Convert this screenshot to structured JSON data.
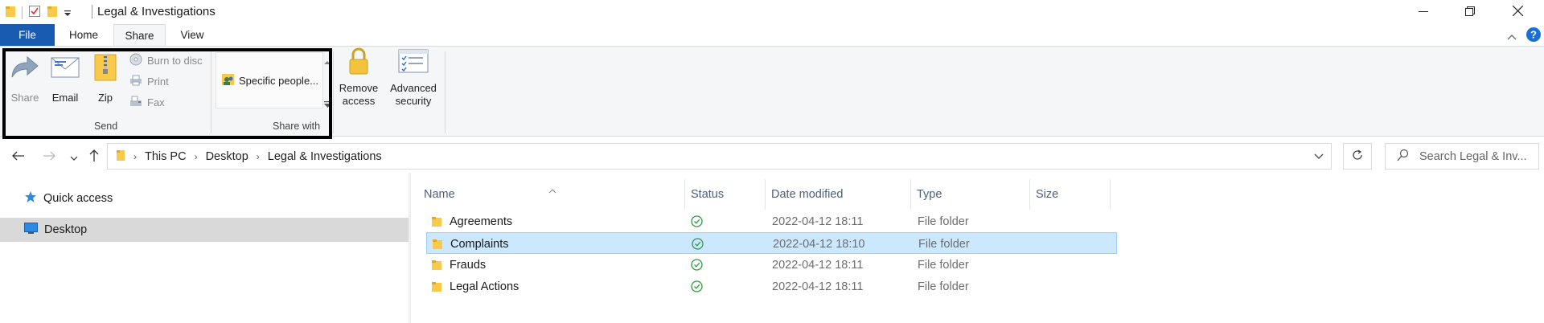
{
  "window": {
    "title": "Legal & Investigations",
    "controls": {
      "minimize_icon": "minimize-icon",
      "maximize_icon": "restore-icon",
      "close_icon": "close-icon"
    }
  },
  "ribbon_tabs": [
    {
      "label": "File"
    },
    {
      "label": "Home"
    },
    {
      "label": "Share"
    },
    {
      "label": "View"
    }
  ],
  "ribbon": {
    "send_group": {
      "label": "Send",
      "share": "Share",
      "email": "Email",
      "zip": "Zip",
      "burn_to_disc": "Burn to disc",
      "print": "Print",
      "fax": "Fax"
    },
    "share_with_group": {
      "label": "Share with",
      "specific_people": "Specific people..."
    },
    "remove_access": {
      "line1": "Remove",
      "line2": "access"
    },
    "advanced_security": {
      "line1": "Advanced",
      "line2": "security"
    }
  },
  "address_bar": {
    "crumbs": [
      "This PC",
      "Desktop",
      "Legal & Investigations"
    ]
  },
  "search": {
    "placeholder": "Search Legal & Inv..."
  },
  "nav_pane": {
    "items": [
      {
        "label": "Quick access",
        "icon": "star-icon"
      },
      {
        "label": "Desktop",
        "icon": "desktop-icon",
        "selected": true
      }
    ]
  },
  "file_list": {
    "columns": [
      "Name",
      "Status",
      "Date modified",
      "Type",
      "Size"
    ],
    "rows": [
      {
        "name": "Agreements",
        "date": "2022-04-12 18:11",
        "type": "File folder",
        "size": ""
      },
      {
        "name": "Complaints",
        "date": "2022-04-12 18:10",
        "type": "File folder",
        "size": "",
        "selected": true
      },
      {
        "name": "Frauds",
        "date": "2022-04-12 18:11",
        "type": "File folder",
        "size": ""
      },
      {
        "name": "Legal Actions",
        "date": "2022-04-12 18:11",
        "type": "File folder",
        "size": ""
      }
    ]
  },
  "colors": {
    "file_tab": "#195bb0",
    "selection": "#cce8ff",
    "folder": "#f8c94a",
    "status_ok": "#2e9a3e",
    "help": "#1a6fd4"
  }
}
